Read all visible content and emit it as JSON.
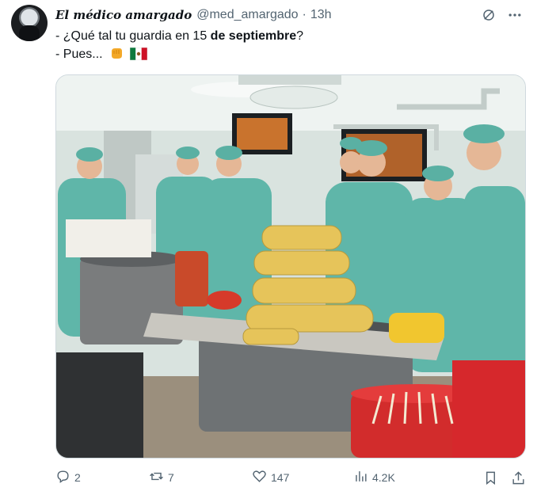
{
  "tweet": {
    "display_name": "El médico amargado",
    "handle": "@med_amargado",
    "separator": "·",
    "time": "13h",
    "line1_prefix": "- ¿Qué tal tu guardia en 15 ",
    "line1_bold": "de septiembre",
    "line1_suffix": "?",
    "line2": "- Pues...",
    "emojis": [
      "raised-fist-emoji",
      "mexico-flag-emoji"
    ]
  },
  "media": {
    "description_icon": "photo"
  },
  "actions": {
    "replies": "2",
    "retweets": "7",
    "likes": "147",
    "views": "4.2K"
  },
  "icons": {
    "grok": "grok-icon",
    "more": "more-icon",
    "reply": "reply-icon",
    "retweet": "retweet-icon",
    "like": "like-icon",
    "views": "views-icon",
    "bookmark": "bookmark-icon",
    "share": "share-icon"
  },
  "colors": {
    "text": "#0f1419",
    "secondary": "#536471",
    "scrub": "#64b5a8"
  }
}
